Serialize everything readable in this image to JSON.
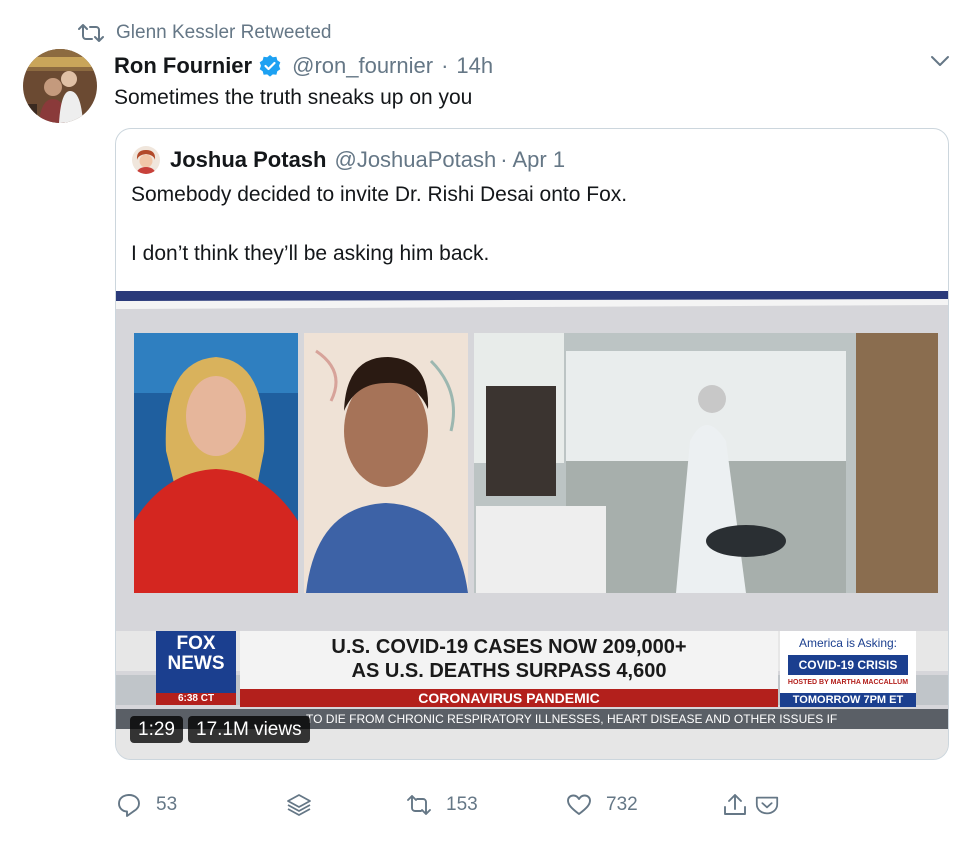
{
  "retweet_banner": {
    "text": "Glenn Kessler Retweeted",
    "icon": "retweet-icon"
  },
  "tweet": {
    "author_name": "Ron Fournier",
    "handle": "@ron_fournier",
    "separator": "·",
    "time": "14h",
    "text": "Sometimes the truth sneaks up on you",
    "verified_color": "#1da1f2"
  },
  "quoted_tweet": {
    "author_name": "Joshua Potash",
    "handle": "@JoshuaPotash",
    "date": "· Apr 1",
    "text_line1": "Somebody decided to invite Dr. Rishi Desai onto Fox.",
    "text_line2": "I don’t think they’ll be asking him back."
  },
  "video": {
    "duration": "1:29",
    "views": "17.1M views",
    "lower_third": {
      "logo_line1": "FOX",
      "logo_line2": "NEWS",
      "clock": "6:38 CT",
      "headline1": "U.S. COVID-19 CASES NOW 209,000+",
      "headline2": "AS U.S. DEATHS SURPASS 4,600",
      "bar": "CORONAVIRUS PANDEMIC",
      "promo1": "America is Asking:",
      "promo2": "COVID-19 CRISIS",
      "promo3": "HOSTED BY MARTHA MACCALLUM",
      "promo4": "TOMORROW 7PM ET",
      "ticker": "TO DIE FROM CHRONIC RESPIRATORY ILLNESSES, HEART DISEASE AND OTHER ISSUES IF"
    }
  },
  "actions": {
    "reply_count": "53",
    "retweet_count": "153",
    "like_count": "732"
  },
  "colors": {
    "link_blue": "#1da1f2",
    "muted": "#657786",
    "fox_red": "#b3201c",
    "fox_blue": "#1b3f8f"
  }
}
